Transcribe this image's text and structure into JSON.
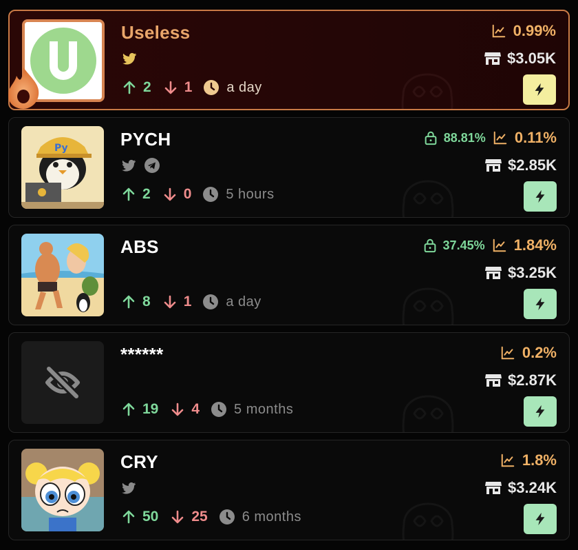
{
  "tokens": [
    {
      "name": "Useless",
      "socials": [
        "twitter-icon"
      ],
      "up": "2",
      "down": "1",
      "age": "a day",
      "lock": "",
      "change": "0.99%",
      "mcap": "$3.05K",
      "featured": true
    },
    {
      "name": "PYCH",
      "socials": [
        "twitter-icon",
        "telegram-icon"
      ],
      "up": "2",
      "down": "0",
      "age": "5 hours",
      "lock": "88.81%",
      "change": "0.11%",
      "mcap": "$2.85K"
    },
    {
      "name": "ABS",
      "socials": [],
      "up": "8",
      "down": "1",
      "age": "a day",
      "lock": "37.45%",
      "change": "1.84%",
      "mcap": "$3.25K"
    },
    {
      "name": "******",
      "socials": [],
      "up": "19",
      "down": "4",
      "age": "5 months",
      "lock": "",
      "change": "0.2%",
      "mcap": "$2.87K"
    },
    {
      "name": "CRY",
      "socials": [
        "twitter-icon"
      ],
      "up": "50",
      "down": "25",
      "age": "6 months",
      "lock": "",
      "change": "1.8%",
      "mcap": "$3.24K"
    }
  ],
  "colors": {
    "accent_green": "#7fd89b",
    "accent_red": "#ef8c8c",
    "accent_orange": "#f0b166",
    "featured_border": "#c97a46",
    "bolt_green": "#a8e6b9",
    "bolt_yellow": "#f4ee9f"
  }
}
